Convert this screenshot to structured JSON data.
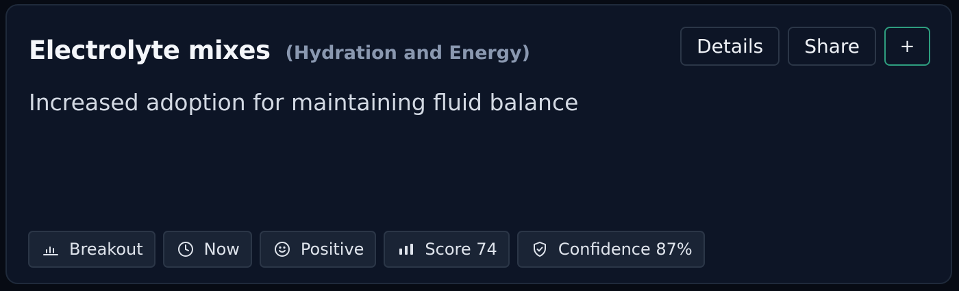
{
  "card": {
    "title": "Electrolyte mixes",
    "category": "(Hydration and Energy)",
    "description": "Increased adoption for maintaining fluid balance"
  },
  "actions": {
    "details_label": "Details",
    "share_label": "Share",
    "add_label": "+"
  },
  "tags": [
    {
      "label": "Breakout",
      "icon": "bar-chart-icon"
    },
    {
      "label": "Now",
      "icon": "clock-icon"
    },
    {
      "label": "Positive",
      "icon": "smiley-icon"
    },
    {
      "label": "Score 74",
      "icon": "score-bars-icon"
    },
    {
      "label": "Confidence 87%",
      "icon": "shield-check-icon"
    }
  ],
  "colors": {
    "background": "#070b14",
    "card": "#0d1526",
    "accent": "#2e9e7f"
  }
}
